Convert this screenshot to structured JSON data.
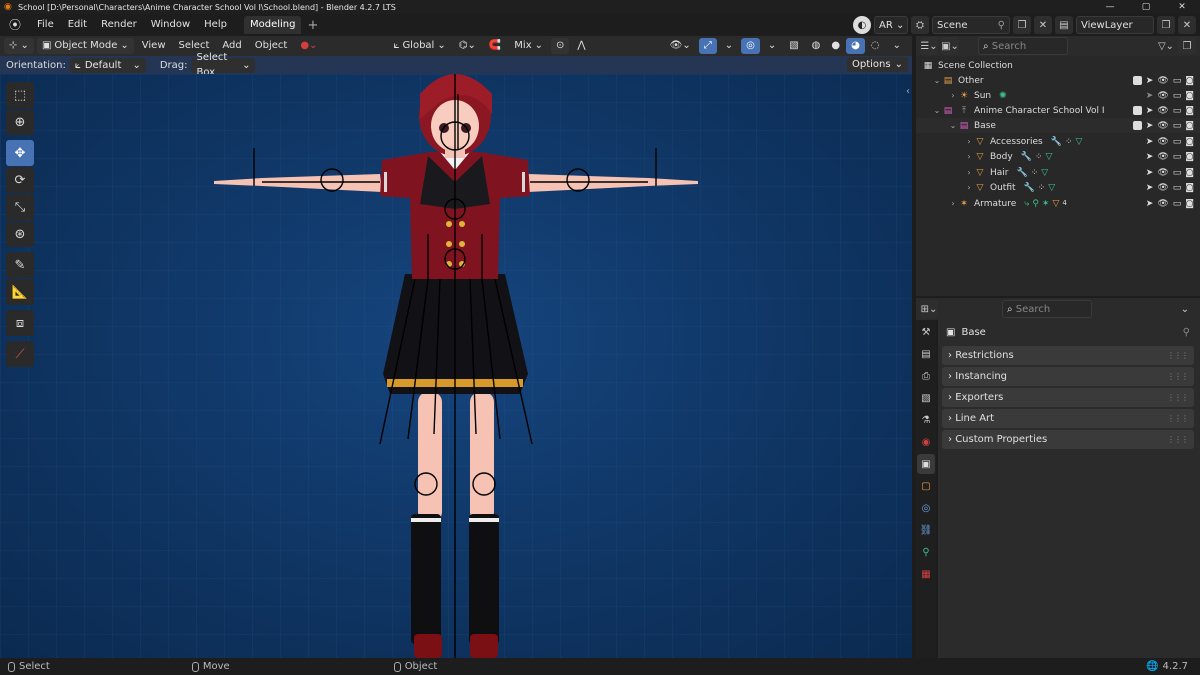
{
  "window": {
    "title": "School [D:\\Personal\\Characters\\Anime Character School Vol I\\School.blend] - Blender 4.2.7 LTS",
    "controls": [
      "—",
      "▢",
      "✕"
    ]
  },
  "menubar": {
    "items": [
      "File",
      "Edit",
      "Render",
      "Window",
      "Help"
    ],
    "workspace_tab": "Modeling",
    "ar_label": "AR",
    "scene_label": "Scene",
    "viewlayer_label": "ViewLayer"
  },
  "viewport_header": {
    "mode": "Object Mode",
    "menus": [
      "View",
      "Select",
      "Add",
      "Object"
    ],
    "transform_orientation": "Global",
    "pivot": "Mix"
  },
  "tool_settings": {
    "orientation_label": "Orientation:",
    "orientation_value": "Default",
    "drag_label": "Drag:",
    "drag_value": "Select Box",
    "options_label": "Options"
  },
  "toolbar": {
    "tools": [
      "select-box",
      "cursor",
      "move",
      "rotate",
      "scale",
      "transform",
      "annotate",
      "measure",
      "add-cube",
      "transform-gizmo"
    ],
    "active": "move"
  },
  "outliner": {
    "search_placeholder": "Search",
    "rows": [
      {
        "name": "Scene Collection",
        "depth": 0,
        "icon": "scene-collection"
      },
      {
        "name": "Other",
        "depth": 1,
        "icon": "collection"
      },
      {
        "name": "Sun",
        "depth": 2,
        "icon": "light"
      },
      {
        "name": "Anime Character School Vol I",
        "depth": 1,
        "icon": "collection"
      },
      {
        "name": "Base",
        "depth": 2,
        "icon": "collection"
      },
      {
        "name": "Accessories",
        "depth": 3,
        "icon": "mesh"
      },
      {
        "name": "Body",
        "depth": 3,
        "icon": "mesh"
      },
      {
        "name": "Hair",
        "depth": 3,
        "icon": "mesh"
      },
      {
        "name": "Outfit",
        "depth": 3,
        "icon": "mesh"
      },
      {
        "name": "Armature",
        "depth": 2,
        "icon": "armature"
      }
    ],
    "armature_badge": "4"
  },
  "properties": {
    "search_placeholder": "Search",
    "object_title": "Base",
    "panels": [
      "Restrictions",
      "Instancing",
      "Exporters",
      "Line Art",
      "Custom Properties"
    ]
  },
  "statusbar": {
    "left": "Select",
    "middle": "Move",
    "right": "Object",
    "version": "4.2.7"
  },
  "colors": {
    "accent": "#4772b3",
    "viewport_bg": "#0f3563",
    "orange": "#e8a04a",
    "green": "#3fc08a"
  }
}
